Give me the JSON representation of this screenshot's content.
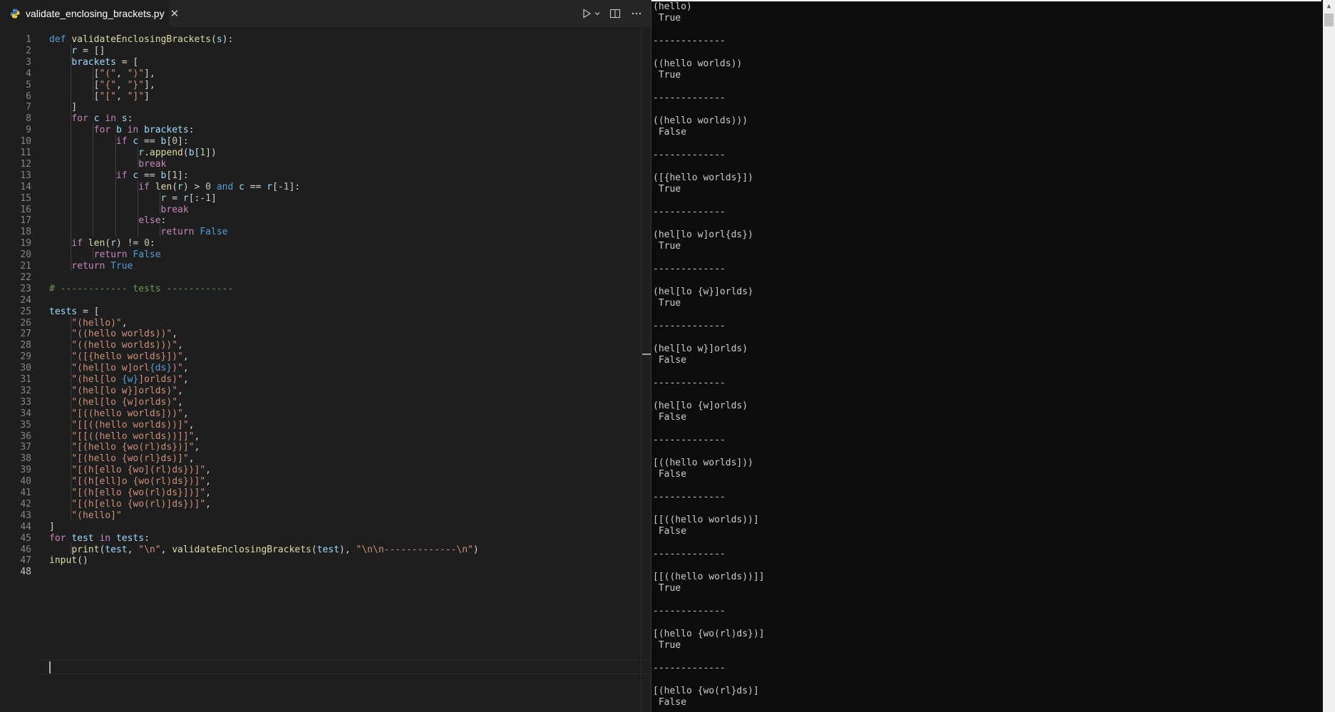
{
  "tab": {
    "filename": "validate_enclosing_brackets.py",
    "close_glyph": "✕"
  },
  "toolbar": {
    "run_glyph": "▷",
    "run_menu_glyph": "⌄",
    "split_glyph": "◫",
    "more_glyph": "···"
  },
  "theme": {
    "editor_bg": "#1e1e1e",
    "console_bg": "#0c0c0c",
    "keyword": "#569cd6",
    "control": "#c586c0",
    "string": "#ce9178",
    "function": "#dcdcaa",
    "variable": "#9cdcfe",
    "number": "#b5cea8",
    "comment": "#6a9955"
  },
  "code": [
    [
      [
        "kw",
        "def"
      ],
      [
        "pn",
        " "
      ],
      [
        "fn",
        "validateEnclosingBrackets"
      ],
      [
        "pn",
        "("
      ],
      [
        "var",
        "s"
      ],
      [
        "pn",
        "):"
      ]
    ],
    [
      [
        "pn",
        "    "
      ],
      [
        "var",
        "r"
      ],
      [
        "pn",
        " = []"
      ]
    ],
    [
      [
        "pn",
        "    "
      ],
      [
        "var",
        "brackets"
      ],
      [
        "pn",
        " = ["
      ]
    ],
    [
      [
        "pn",
        "        ["
      ],
      [
        "str",
        "\"(\""
      ],
      [
        "pn",
        ", "
      ],
      [
        "str",
        "\")\""
      ],
      [
        "pn",
        "],"
      ]
    ],
    [
      [
        "pn",
        "        ["
      ],
      [
        "str",
        "\"{\""
      ],
      [
        "pn",
        ", "
      ],
      [
        "str",
        "\"}\""
      ],
      [
        "pn",
        "],"
      ]
    ],
    [
      [
        "pn",
        "        ["
      ],
      [
        "str",
        "\"[\""
      ],
      [
        "pn",
        ", "
      ],
      [
        "str",
        "\"]\""
      ],
      [
        "pn",
        "]"
      ]
    ],
    [
      [
        "pn",
        "    ]"
      ]
    ],
    [
      [
        "pn",
        "    "
      ],
      [
        "ctl",
        "for"
      ],
      [
        "pn",
        " "
      ],
      [
        "var",
        "c"
      ],
      [
        "pn",
        " "
      ],
      [
        "ctl",
        "in"
      ],
      [
        "pn",
        " "
      ],
      [
        "var",
        "s"
      ],
      [
        "pn",
        ":"
      ]
    ],
    [
      [
        "pn",
        "        "
      ],
      [
        "ctl",
        "for"
      ],
      [
        "pn",
        " "
      ],
      [
        "var",
        "b"
      ],
      [
        "pn",
        " "
      ],
      [
        "ctl",
        "in"
      ],
      [
        "pn",
        " "
      ],
      [
        "var",
        "brackets"
      ],
      [
        "pn",
        ":"
      ]
    ],
    [
      [
        "pn",
        "            "
      ],
      [
        "ctl",
        "if"
      ],
      [
        "pn",
        " "
      ],
      [
        "var",
        "c"
      ],
      [
        "pn",
        " == "
      ],
      [
        "var",
        "b"
      ],
      [
        "pn",
        "["
      ],
      [
        "num",
        "0"
      ],
      [
        "pn",
        "]:"
      ]
    ],
    [
      [
        "pn",
        "                "
      ],
      [
        "var",
        "r"
      ],
      [
        "pn",
        "."
      ],
      [
        "fn",
        "append"
      ],
      [
        "pn",
        "("
      ],
      [
        "var",
        "b"
      ],
      [
        "pn",
        "["
      ],
      [
        "num",
        "1"
      ],
      [
        "pn",
        "])"
      ]
    ],
    [
      [
        "pn",
        "                "
      ],
      [
        "ctl",
        "break"
      ]
    ],
    [
      [
        "pn",
        "            "
      ],
      [
        "ctl",
        "if"
      ],
      [
        "pn",
        " "
      ],
      [
        "var",
        "c"
      ],
      [
        "pn",
        " == "
      ],
      [
        "var",
        "b"
      ],
      [
        "pn",
        "["
      ],
      [
        "num",
        "1"
      ],
      [
        "pn",
        "]:"
      ]
    ],
    [
      [
        "pn",
        "                "
      ],
      [
        "ctl",
        "if"
      ],
      [
        "pn",
        " "
      ],
      [
        "fn",
        "len"
      ],
      [
        "pn",
        "("
      ],
      [
        "var",
        "r"
      ],
      [
        "pn",
        ") > "
      ],
      [
        "num",
        "0"
      ],
      [
        "pn",
        " "
      ],
      [
        "kw",
        "and"
      ],
      [
        "pn",
        " "
      ],
      [
        "var",
        "c"
      ],
      [
        "pn",
        " == "
      ],
      [
        "var",
        "r"
      ],
      [
        "pn",
        "[-"
      ],
      [
        "num",
        "1"
      ],
      [
        "pn",
        "]:"
      ]
    ],
    [
      [
        "pn",
        "                    "
      ],
      [
        "var",
        "r"
      ],
      [
        "pn",
        " = "
      ],
      [
        "var",
        "r"
      ],
      [
        "pn",
        "[:-"
      ],
      [
        "num",
        "1"
      ],
      [
        "pn",
        "]"
      ]
    ],
    [
      [
        "pn",
        "                    "
      ],
      [
        "ctl",
        "break"
      ]
    ],
    [
      [
        "pn",
        "                "
      ],
      [
        "ctl",
        "else"
      ],
      [
        "pn",
        ":"
      ]
    ],
    [
      [
        "pn",
        "                    "
      ],
      [
        "ctl",
        "return"
      ],
      [
        "pn",
        " "
      ],
      [
        "kw",
        "False"
      ]
    ],
    [
      [
        "pn",
        "    "
      ],
      [
        "ctl",
        "if"
      ],
      [
        "pn",
        " "
      ],
      [
        "fn",
        "len"
      ],
      [
        "pn",
        "("
      ],
      [
        "var",
        "r"
      ],
      [
        "pn",
        ") != "
      ],
      [
        "num",
        "0"
      ],
      [
        "pn",
        ":"
      ]
    ],
    [
      [
        "pn",
        "        "
      ],
      [
        "ctl",
        "return"
      ],
      [
        "pn",
        " "
      ],
      [
        "kw",
        "False"
      ]
    ],
    [
      [
        "pn",
        "    "
      ],
      [
        "ctl",
        "return"
      ],
      [
        "pn",
        " "
      ],
      [
        "kw",
        "True"
      ]
    ],
    [],
    [
      [
        "cmt",
        "# ------------ tests ------------"
      ]
    ],
    [],
    [
      [
        "var",
        "tests"
      ],
      [
        "pn",
        " = ["
      ]
    ],
    [
      [
        "pn",
        "    "
      ],
      [
        "str",
        "\"(hello)\""
      ],
      [
        "pn",
        ","
      ]
    ],
    [
      [
        "pn",
        "    "
      ],
      [
        "str",
        "\"((hello worlds))\""
      ],
      [
        "pn",
        ","
      ]
    ],
    [
      [
        "pn",
        "    "
      ],
      [
        "str",
        "\"((hello worlds)))\""
      ],
      [
        "pn",
        ","
      ]
    ],
    [
      [
        "pn",
        "    "
      ],
      [
        "str",
        "\"([{hello worlds}])\""
      ],
      [
        "pn",
        ","
      ]
    ],
    [
      [
        "pn",
        "    "
      ],
      [
        "str",
        "\"(hel[lo w]orl"
      ],
      [
        "kw",
        "{ds}"
      ],
      [
        "str",
        ")\""
      ],
      [
        "pn",
        ","
      ]
    ],
    [
      [
        "pn",
        "    "
      ],
      [
        "str",
        "\"(hel[lo "
      ],
      [
        "kw",
        "{w}"
      ],
      [
        "str",
        "]orlds)\""
      ],
      [
        "pn",
        ","
      ]
    ],
    [
      [
        "pn",
        "    "
      ],
      [
        "str",
        "\"(hel[lo w}]orlds)\""
      ],
      [
        "pn",
        ","
      ]
    ],
    [
      [
        "pn",
        "    "
      ],
      [
        "str",
        "\"(hel[lo {w]orlds)\""
      ],
      [
        "pn",
        ","
      ]
    ],
    [
      [
        "pn",
        "    "
      ],
      [
        "str",
        "\"[((hello worlds]))\""
      ],
      [
        "pn",
        ","
      ]
    ],
    [
      [
        "pn",
        "    "
      ],
      [
        "str",
        "\"[[((hello worlds))]\""
      ],
      [
        "pn",
        ","
      ]
    ],
    [
      [
        "pn",
        "    "
      ],
      [
        "str",
        "\"[[((hello worlds))]]\""
      ],
      [
        "pn",
        ","
      ]
    ],
    [
      [
        "pn",
        "    "
      ],
      [
        "str",
        "\"[(hello {wo(rl)ds})]\""
      ],
      [
        "pn",
        ","
      ]
    ],
    [
      [
        "pn",
        "    "
      ],
      [
        "str",
        "\"[(hello {wo(rl}ds)]\""
      ],
      [
        "pn",
        ","
      ]
    ],
    [
      [
        "pn",
        "    "
      ],
      [
        "str",
        "\"[(h[ello {wo](rl)ds})]\""
      ],
      [
        "pn",
        ","
      ]
    ],
    [
      [
        "pn",
        "    "
      ],
      [
        "str",
        "\"[(h[ell]o {wo(rl)ds})]\""
      ],
      [
        "pn",
        ","
      ]
    ],
    [
      [
        "pn",
        "    "
      ],
      [
        "str",
        "\"[(h[ello {wo(rl)ds}])]\""
      ],
      [
        "pn",
        ","
      ]
    ],
    [
      [
        "pn",
        "    "
      ],
      [
        "str",
        "\"[(h[ello {wo(rl)]ds})]\""
      ],
      [
        "pn",
        ","
      ]
    ],
    [
      [
        "pn",
        "    "
      ],
      [
        "str",
        "\"(hello]\""
      ]
    ],
    [
      [
        "pn",
        "]"
      ]
    ],
    [
      [
        "ctl",
        "for"
      ],
      [
        "pn",
        " "
      ],
      [
        "var",
        "test"
      ],
      [
        "pn",
        " "
      ],
      [
        "ctl",
        "in"
      ],
      [
        "pn",
        " "
      ],
      [
        "var",
        "tests"
      ],
      [
        "pn",
        ":"
      ]
    ],
    [
      [
        "pn",
        "    "
      ],
      [
        "fn",
        "print"
      ],
      [
        "pn",
        "("
      ],
      [
        "var",
        "test"
      ],
      [
        "pn",
        ", "
      ],
      [
        "str",
        "\"\\n\""
      ],
      [
        "pn",
        ", "
      ],
      [
        "fn",
        "validateEnclosingBrackets"
      ],
      [
        "pn",
        "("
      ],
      [
        "var",
        "test"
      ],
      [
        "pn",
        "), "
      ],
      [
        "str",
        "\"\\n\\n-------------\\n\""
      ],
      [
        "pn",
        ")"
      ]
    ],
    [
      [
        "fn",
        "input"
      ],
      [
        "pn",
        "()"
      ]
    ],
    []
  ],
  "console": [
    "(hello)",
    " True",
    "",
    "-------------",
    "",
    "((hello worlds))",
    " True",
    "",
    "-------------",
    "",
    "((hello worlds)))",
    " False",
    "",
    "-------------",
    "",
    "([{hello worlds}])",
    " True",
    "",
    "-------------",
    "",
    "(hel[lo w]orl{ds})",
    " True",
    "",
    "-------------",
    "",
    "(hel[lo {w}]orlds)",
    " True",
    "",
    "-------------",
    "",
    "(hel[lo w}]orlds)",
    " False",
    "",
    "-------------",
    "",
    "(hel[lo {w]orlds)",
    " False",
    "",
    "-------------",
    "",
    "[((hello worlds]))",
    " False",
    "",
    "-------------",
    "",
    "[[((hello worlds))]",
    " False",
    "",
    "-------------",
    "",
    "[[((hello worlds))]]",
    " True",
    "",
    "-------------",
    "",
    "[(hello {wo(rl)ds})]",
    " True",
    "",
    "-------------",
    "",
    "[(hello {wo(rl}ds)]",
    " False"
  ],
  "console_scroll_up_glyph": "▲"
}
